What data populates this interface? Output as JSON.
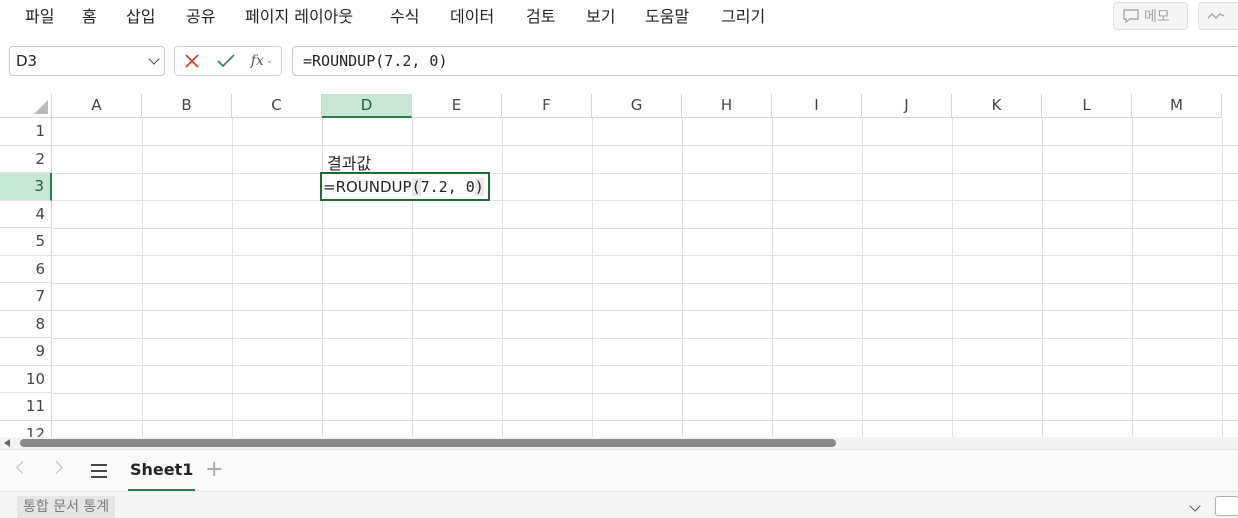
{
  "menu": {
    "items": [
      "파일",
      "홈",
      "삽입",
      "공유",
      "페이지 레이아웃",
      "수식",
      "데이터",
      "검토",
      "보기",
      "도움말",
      "그리기"
    ],
    "memo_label": "메모"
  },
  "formula_bar": {
    "name_box": "D3",
    "fx_label": "fx",
    "formula": "=ROUNDUP(7.2, 0)"
  },
  "grid": {
    "columns": [
      "A",
      "B",
      "C",
      "D",
      "E",
      "F",
      "G",
      "H",
      "I",
      "J",
      "K",
      "L",
      "M"
    ],
    "rows": [
      "1",
      "2",
      "3",
      "4",
      "5",
      "6",
      "7",
      "8",
      "9",
      "10",
      "11",
      "12"
    ],
    "selected_column": "D",
    "selected_row": "3",
    "cells": {
      "D2": "결과값",
      "D3_prefix": "=ROUNDUP",
      "D3_open": "(",
      "D3_args": "7.2, 0",
      "D3_close": ")"
    }
  },
  "sheets": {
    "active": "Sheet1"
  },
  "status": {
    "text": "통합 문서 통계"
  },
  "colors": {
    "accent": "#2f7a4a",
    "header_selected": "#c7e6d3",
    "cancel": "#d13438",
    "confirm": "#2f7a4a"
  }
}
